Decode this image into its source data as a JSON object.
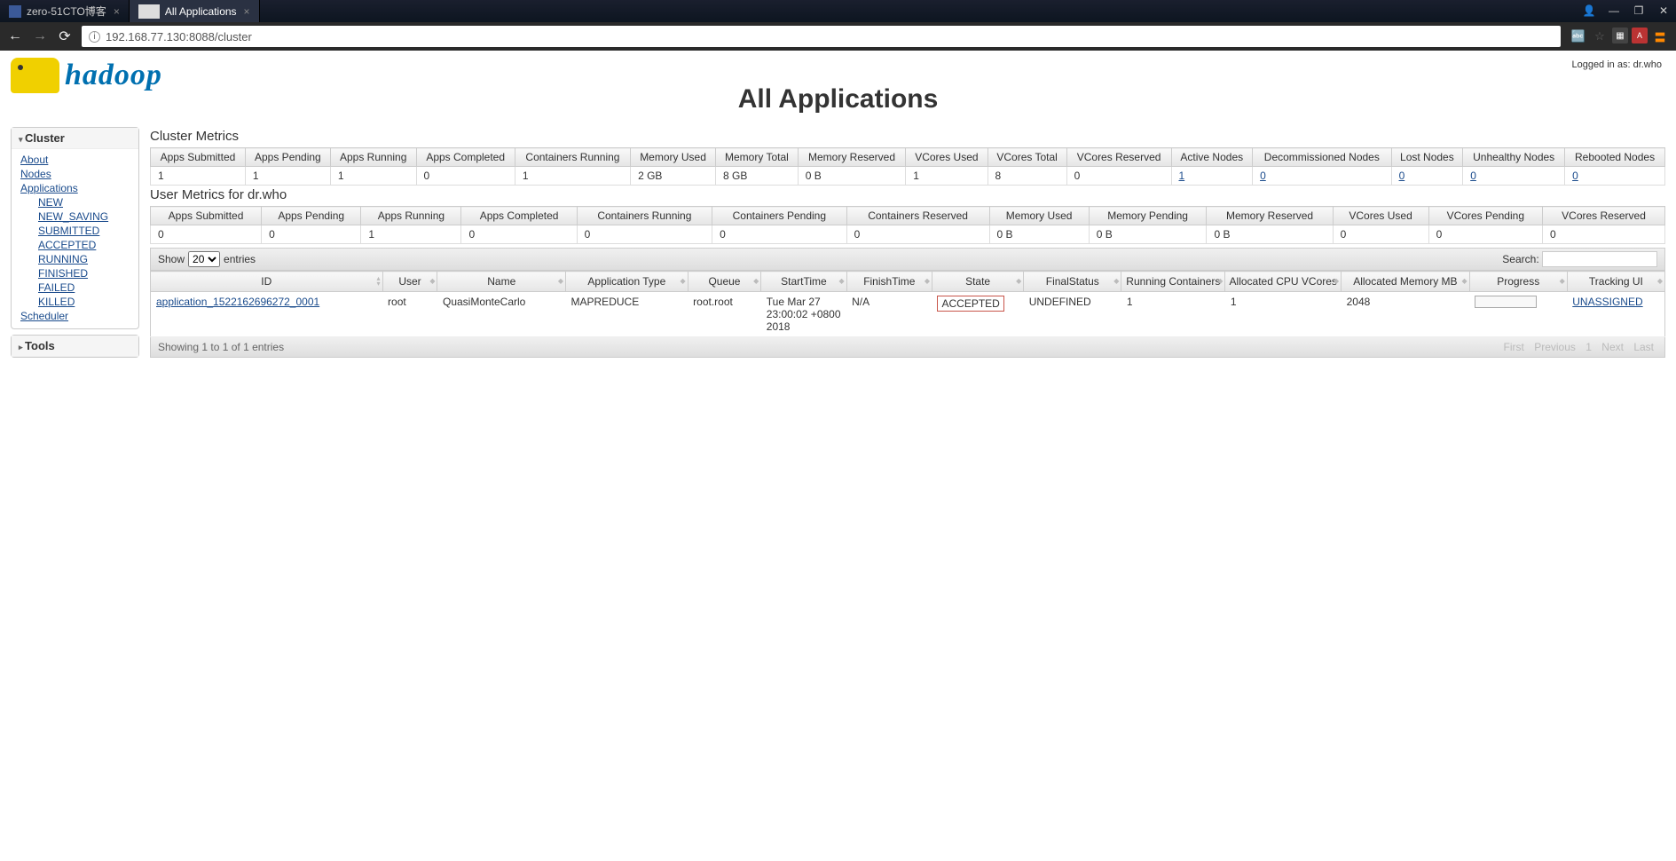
{
  "browser": {
    "tab1": "zero-51CTO博客",
    "tab2": "All Applications",
    "url": "192.168.77.130:8088/cluster"
  },
  "header": {
    "logo_text": "hadoop",
    "login_info": "Logged in as: dr.who",
    "page_title": "All Applications"
  },
  "sidebar": {
    "cluster_head": "Cluster",
    "about": "About",
    "nodes": "Nodes",
    "applications": "Applications",
    "new": "NEW",
    "new_saving": "NEW_SAVING",
    "submitted": "SUBMITTED",
    "accepted": "ACCEPTED",
    "running": "RUNNING",
    "finished": "FINISHED",
    "failed": "FAILED",
    "killed": "KILLED",
    "scheduler": "Scheduler",
    "tools_head": "Tools"
  },
  "cluster_metrics": {
    "title": "Cluster Metrics",
    "headers": {
      "apps_submitted": "Apps Submitted",
      "apps_pending": "Apps Pending",
      "apps_running": "Apps Running",
      "apps_completed": "Apps Completed",
      "containers_running": "Containers Running",
      "memory_used": "Memory Used",
      "memory_total": "Memory Total",
      "memory_reserved": "Memory Reserved",
      "vcores_used": "VCores Used",
      "vcores_total": "VCores Total",
      "vcores_reserved": "VCores Reserved",
      "active_nodes": "Active Nodes",
      "decommissioned_nodes": "Decommissioned Nodes",
      "lost_nodes": "Lost Nodes",
      "unhealthy_nodes": "Unhealthy Nodes",
      "rebooted_nodes": "Rebooted Nodes"
    },
    "values": {
      "apps_submitted": "1",
      "apps_pending": "1",
      "apps_running": "1",
      "apps_completed": "0",
      "containers_running": "1",
      "memory_used": "2 GB",
      "memory_total": "8 GB",
      "memory_reserved": "0 B",
      "vcores_used": "1",
      "vcores_total": "8",
      "vcores_reserved": "0",
      "active_nodes": "1",
      "decommissioned_nodes": "0",
      "lost_nodes": "0",
      "unhealthy_nodes": "0",
      "rebooted_nodes": "0"
    }
  },
  "user_metrics": {
    "title": "User Metrics for dr.who",
    "headers": {
      "apps_submitted": "Apps Submitted",
      "apps_pending": "Apps Pending",
      "apps_running": "Apps Running",
      "apps_completed": "Apps Completed",
      "containers_running": "Containers Running",
      "containers_pending": "Containers Pending",
      "containers_reserved": "Containers Reserved",
      "memory_used": "Memory Used",
      "memory_pending": "Memory Pending",
      "memory_reserved": "Memory Reserved",
      "vcores_used": "VCores Used",
      "vcores_pending": "VCores Pending",
      "vcores_reserved": "VCores Reserved"
    },
    "values": {
      "apps_submitted": "0",
      "apps_pending": "0",
      "apps_running": "1",
      "apps_completed": "0",
      "containers_running": "0",
      "containers_pending": "0",
      "containers_reserved": "0",
      "memory_used": "0 B",
      "memory_pending": "0 B",
      "memory_reserved": "0 B",
      "vcores_used": "0",
      "vcores_pending": "0",
      "vcores_reserved": "0"
    }
  },
  "apps_table": {
    "show_label_pre": "Show",
    "show_value": "20",
    "show_label_post": "entries",
    "search_label": "Search:",
    "headers": {
      "id": "ID",
      "user": "User",
      "name": "Name",
      "app_type": "Application Type",
      "queue": "Queue",
      "start_time": "StartTime",
      "finish_time": "FinishTime",
      "state": "State",
      "final_status": "FinalStatus",
      "running_containers": "Running Containers",
      "alloc_cpu": "Allocated CPU VCores",
      "alloc_mem": "Allocated Memory MB",
      "progress": "Progress",
      "tracking_ui": "Tracking UI"
    },
    "row": {
      "id": "application_1522162696272_0001",
      "user": "root",
      "name": "QuasiMonteCarlo",
      "app_type": "MAPREDUCE",
      "queue": "root.root",
      "start_time": "Tue Mar 27 23:00:02 +0800 2018",
      "finish_time": "N/A",
      "state": "ACCEPTED",
      "final_status": "UNDEFINED",
      "running_containers": "1",
      "alloc_cpu": "1",
      "alloc_mem": "2048",
      "tracking_ui": "UNASSIGNED"
    },
    "footer_showing": "Showing 1 to 1 of 1 entries",
    "paging": {
      "first": "First",
      "prev": "Previous",
      "one": "1",
      "next": "Next",
      "last": "Last"
    }
  }
}
